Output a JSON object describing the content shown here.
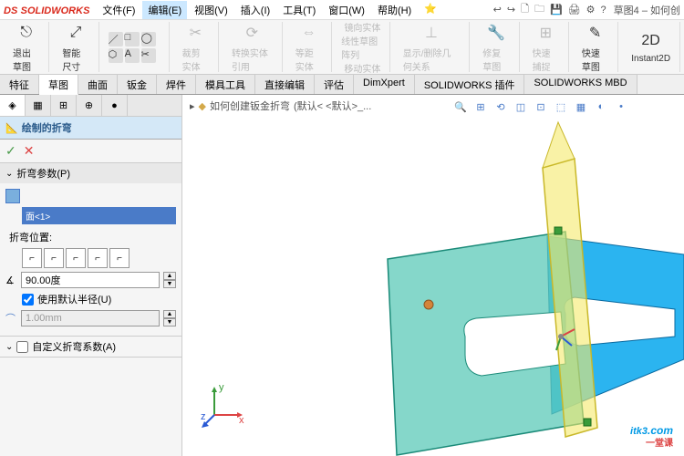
{
  "app": {
    "logo_prefix": "DS",
    "logo_name": "SOLIDWORKS",
    "doc_title": "草图4 – 如何创"
  },
  "menu": [
    {
      "label": "文件(F)"
    },
    {
      "label": "编辑(E)",
      "active": true
    },
    {
      "label": "视图(V)"
    },
    {
      "label": "插入(I)"
    },
    {
      "label": "工具(T)"
    },
    {
      "label": "窗口(W)"
    },
    {
      "label": "帮助(H)"
    },
    {
      "label": "⭐"
    }
  ],
  "title_icons": [
    "↩",
    "↪",
    "🗋",
    "🗀",
    "💾",
    "🖨",
    "⚙",
    "?"
  ],
  "ribbon": {
    "groups": [
      {
        "label": "退出草图",
        "icon": "⎋"
      },
      {
        "label": "智能尺寸",
        "icon": "⤢"
      },
      {
        "sub": [
          "／",
          "□",
          "◯",
          "⬡",
          "A",
          "✂"
        ]
      },
      {
        "label": "裁剪实体",
        "icon": "✂",
        "disabled": true
      },
      {
        "label": "转换实体引用",
        "icon": "⟳",
        "disabled": true
      },
      {
        "label": "等距实体",
        "icon": "⇔",
        "disabled": true
      },
      {
        "sub_labels": [
          "镜向实体",
          "线性草图阵列",
          "移动实体"
        ],
        "disabled": true
      },
      {
        "label": "显示/删除几何关系",
        "icon": "⊥",
        "disabled": true
      },
      {
        "label": "修复草图",
        "icon": "🔧",
        "disabled": true
      },
      {
        "label": "快速捕捉",
        "icon": "⊞",
        "disabled": true
      },
      {
        "label": "快速草图",
        "icon": "✎"
      },
      {
        "label": "Instant2D",
        "icon": "2D"
      }
    ]
  },
  "tabs": [
    "特征",
    "草图",
    "曲面",
    "钣金",
    "焊件",
    "模具工具",
    "直接编辑",
    "评估",
    "DimXpert",
    "SOLIDWORKS 插件",
    "SOLIDWORKS MBD"
  ],
  "active_tab": 1,
  "sidebar": {
    "tab_icons": [
      "◈",
      "▦",
      "⊞",
      "⊕",
      "●"
    ],
    "feature": {
      "icon": "📐",
      "title": "绘制的折弯"
    },
    "ok": "✓",
    "cancel": "✕",
    "section1": {
      "header": "折弯参数(P)",
      "face_icon": "▱",
      "face_sel": "面<1>",
      "pos_label": "折弯位置:",
      "pos_icons": [
        "⌐",
        "⌐",
        "⌐",
        "⌐",
        "⌐"
      ],
      "angle_icon": "∡",
      "angle_value": "90.00度",
      "use_default_chk": true,
      "use_default_label": "使用默认半径(U)",
      "radius_icon": "⌒",
      "radius_value": "1.00mm"
    },
    "section2": {
      "header": "自定义折弯系数(A)",
      "checked": false
    }
  },
  "viewport": {
    "breadcrumb_icon": "▸",
    "breadcrumb_part": "如何创建钣金折弯",
    "breadcrumb_config": "(默认< <默认>_...",
    "toolbar_icons": [
      "🔍",
      "⊞",
      "⟲",
      "◫",
      "⊡",
      "⬚",
      "▦",
      "◐",
      "•"
    ],
    "axes": {
      "x": "x",
      "y": "y",
      "z": "z"
    }
  },
  "watermark": {
    "main": "itk3",
    "dot": ".com",
    "sub": "一堂课"
  }
}
